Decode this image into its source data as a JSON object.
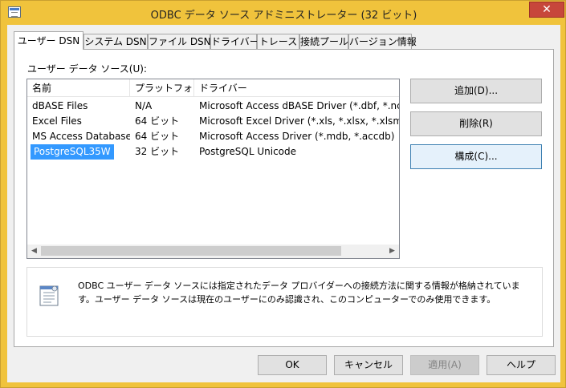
{
  "window": {
    "title": "ODBC データ ソース アドミニストレーター (32 ビット)",
    "close_glyph": "✕"
  },
  "tabs": [
    {
      "label": "ユーザー DSN",
      "active": true
    },
    {
      "label": "システム DSN"
    },
    {
      "label": "ファイル DSN"
    },
    {
      "label": "ドライバー"
    },
    {
      "label": "トレース"
    },
    {
      "label": "接続プール"
    },
    {
      "label": "バージョン情報"
    }
  ],
  "user_dsn": {
    "group_label": "ユーザー データ ソース(U):",
    "columns": [
      "名前",
      "プラットフォーム",
      "ドライバー"
    ],
    "rows": [
      {
        "name": "dBASE Files",
        "platform": "N/A",
        "driver": "Microsoft Access dBASE Driver (*.dbf, *.nc"
      },
      {
        "name": "Excel Files",
        "platform": "64 ビット",
        "driver": "Microsoft Excel Driver (*.xls, *.xlsx, *.xlsm"
      },
      {
        "name": "MS Access Database",
        "platform": "64 ビット",
        "driver": "Microsoft Access Driver (*.mdb, *.accdb)"
      },
      {
        "name": "PostgreSQL35W",
        "platform": "32 ビット",
        "driver": "PostgreSQL Unicode",
        "selected": true
      }
    ],
    "buttons": {
      "add": "追加(D)...",
      "remove": "削除(R)",
      "configure": "構成(C)..."
    },
    "info_text": "ODBC ユーザー データ ソースには指定されたデータ プロバイダーへの接続方法に関する情報が格納されています。ユーザー データ ソースは現在のユーザーにのみ認識され、このコンピューターでのみ使用できます。"
  },
  "scroll_arrows": {
    "left": "◀",
    "right": "▶"
  },
  "footer_buttons": {
    "ok": "OK",
    "cancel": "キャンセル",
    "apply": "適用(A)",
    "help": "ヘルプ"
  },
  "colors": {
    "titlebar": "#f0c33c",
    "selection": "#3399ff",
    "close_button": "#c7473b"
  }
}
